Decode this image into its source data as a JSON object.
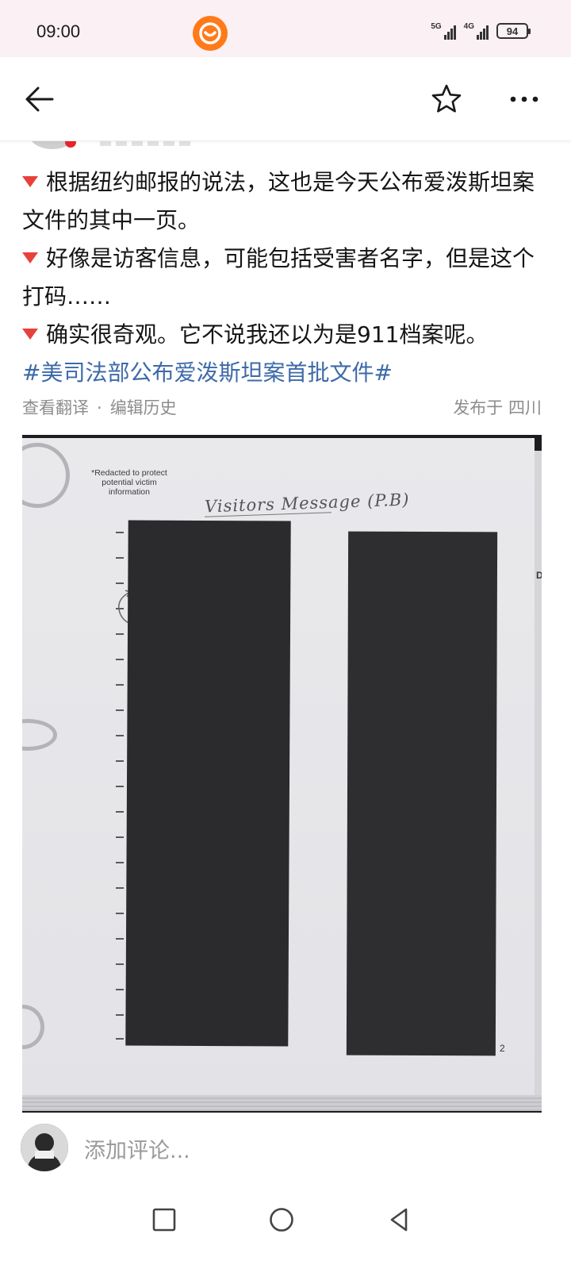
{
  "status_bar": {
    "time": "09:00",
    "network_1": "5G",
    "network_2": "4G",
    "battery": "94"
  },
  "nav": {
    "back_icon": "arrow-left-icon",
    "favorite_icon": "star-outline-icon",
    "more_icon": "more-dots-icon"
  },
  "post": {
    "lines": [
      "根据纽约邮报的说法，这也是今天公布爱泼斯坦案文件的其中一页。",
      "好像是访客信息，可能包括受害者名字，但是这个打码……",
      "确实很奇观。它不说我还以为是911档案呢。"
    ],
    "hashtag": "#美司法部公布爱泼斯坦案首批文件#",
    "translate_label": "查看翻译",
    "edit_history_label": "编辑历史",
    "location": "发布于 四川",
    "bullet_color": "#e8413c"
  },
  "photo": {
    "redaction_note": "*Redacted to protect potential victim information",
    "handwritten_title": "Visitors Message (P.B)",
    "page_number": "2",
    "side_mark": "D"
  },
  "comment_bar": {
    "placeholder": "添加评论..."
  },
  "system_nav": {
    "recents_icon": "square-icon",
    "home_icon": "circle-icon",
    "back_icon": "triangle-back-icon"
  },
  "colors": {
    "status_bg": "#fbf0f3",
    "app_logo": "#ff7a1a",
    "hashtag": "#3d6aa8",
    "meta": "#8c8c8c"
  }
}
